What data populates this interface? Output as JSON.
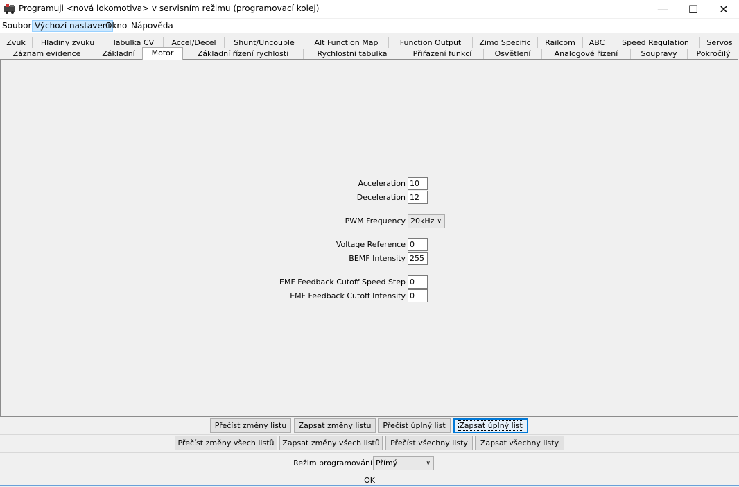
{
  "window": {
    "title": "Programuji <nová lokomotiva> v servisním režimu (programovací kolej)",
    "minimize_glyph": "—",
    "maximize_glyph": "☐",
    "close_glyph": "✕"
  },
  "menu": {
    "file": "Soubor",
    "defaults": "Výchozí nastavení",
    "window": "Okno",
    "help": "Nápověda"
  },
  "tabs_row1": [
    "Zvuk",
    "Hladiny zvuku",
    "Tabulka CV",
    "Accel/Decel",
    "Shunt/Uncouple",
    "Alt Function Map",
    "Function Output",
    "Zimo Specific",
    "Railcom",
    "ABC",
    "Speed Regulation",
    "Servos"
  ],
  "tabs_row2": [
    "Záznam evidence",
    "Základní",
    "Motor",
    "Základní řízení rychlosti",
    "Rychlostní tabulka",
    "Přiřazení funkcí",
    "Osvětlení",
    "Analogové řízení",
    "Soupravy",
    "Pokročilý"
  ],
  "selected_tab": "Motor",
  "motor": {
    "acceleration_label": "Acceleration",
    "acceleration_value": "10",
    "deceleration_label": "Deceleration",
    "deceleration_value": "12",
    "pwm_label": "PWM Frequency",
    "pwm_value": "20kHz",
    "voltage_ref_label": "Voltage Reference",
    "voltage_ref_value": "0",
    "bemf_label": "BEMF Intensity",
    "bemf_value": "255",
    "emf_cutoff_step_label": "EMF Feedback Cutoff Speed Step",
    "emf_cutoff_step_value": "0",
    "emf_cutoff_intensity_label": "EMF Feedback Cutoff Intensity",
    "emf_cutoff_intensity_value": "0"
  },
  "buttons_row1": {
    "read_changes_sheet": "Přečíst změny listu",
    "write_changes_sheet": "Zapsat změny listu",
    "read_full_sheet": "Přečíst úplný list",
    "write_full_sheet": "Zapsat úplný list"
  },
  "buttons_row2": {
    "read_changes_all": "Přečíst změny všech listů",
    "write_changes_all": "Zapsat změny všech listů",
    "read_all": "Přečíst všechny listy",
    "write_all": "Zapsat všechny listy"
  },
  "programming_mode": {
    "label": "Režim programování",
    "value": "Přímý"
  },
  "status": "OK",
  "colors": {
    "focus": "#0078d7",
    "menu_highlight": "#cce8ff",
    "status_line": "#6aa0d8"
  }
}
